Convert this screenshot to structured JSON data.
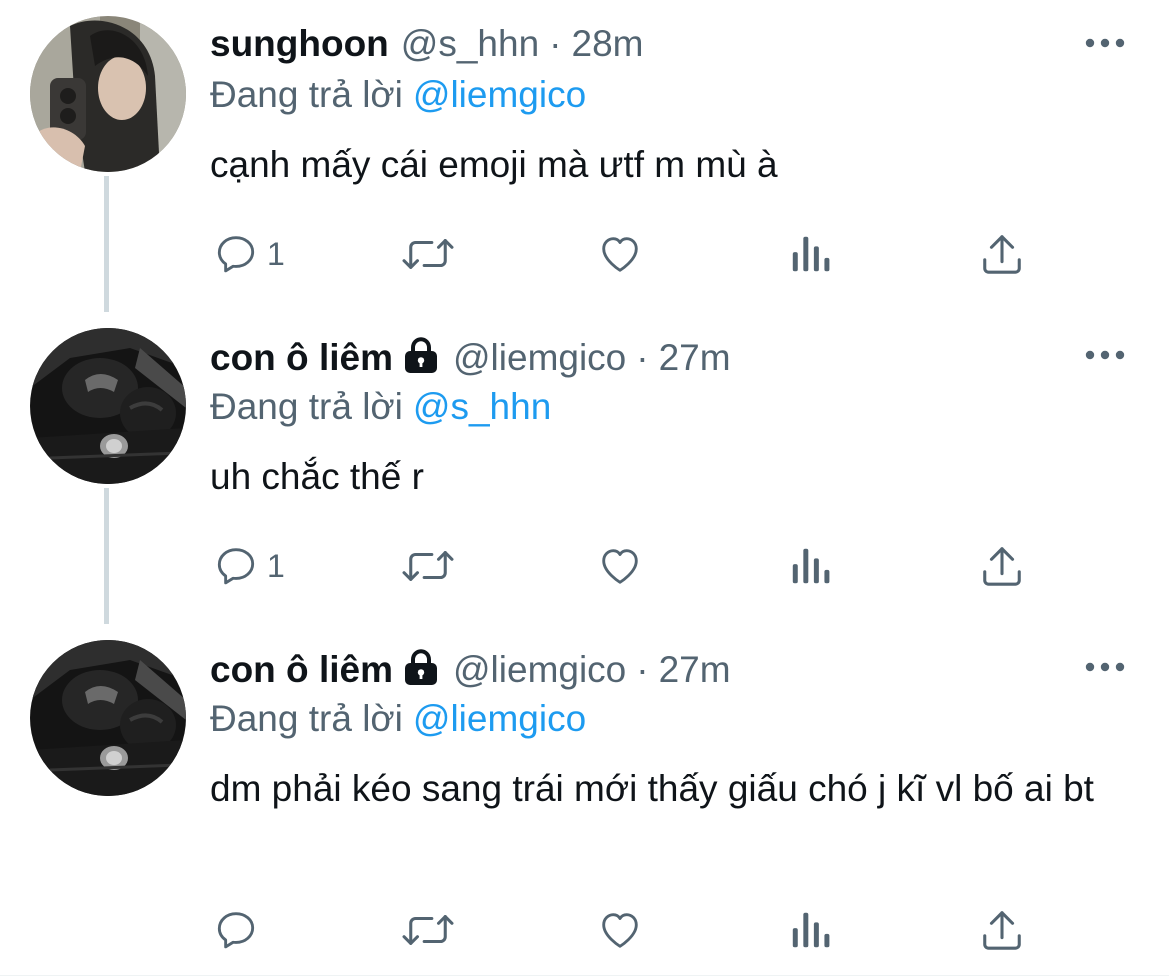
{
  "tweets": [
    {
      "name": "sunghoon",
      "handle": "@s_hhn",
      "dot": "·",
      "time": "28m",
      "protected": false,
      "reply_prefix": "Đang trả lời",
      "reply_to": "@liemgico",
      "text": "cạnh mấy cái emoji mà ưtf m mù à",
      "reply_count": "1",
      "avatar_icon": "selfie-avatar"
    },
    {
      "name": "con ô liêm",
      "handle": "@liemgico",
      "dot": "·",
      "time": "27m",
      "protected": true,
      "reply_prefix": "Đang trả lời",
      "reply_to": "@s_hhn",
      "text": "uh chắc thế r",
      "reply_count": "1",
      "avatar_icon": "boxing-gloves-avatar"
    },
    {
      "name": "con ô liêm",
      "handle": "@liemgico",
      "dot": "·",
      "time": "27m",
      "protected": true,
      "reply_prefix": "Đang trả lời",
      "reply_to": "@liemgico",
      "text": "dm phải kéo sang trái mới thấy giấu chó j kĩ vl bố ai bt",
      "reply_count": "",
      "avatar_icon": "boxing-gloves-avatar"
    }
  ],
  "icons": {
    "more": "more-icon",
    "reply": "reply-icon",
    "retweet": "retweet-icon",
    "like": "like-icon",
    "views": "views-icon",
    "share": "share-icon",
    "lock": "lock-icon"
  },
  "colors": {
    "secondary_text": "#536471",
    "mention": "#1d9bf0",
    "thread_line": "#cfd9de"
  }
}
